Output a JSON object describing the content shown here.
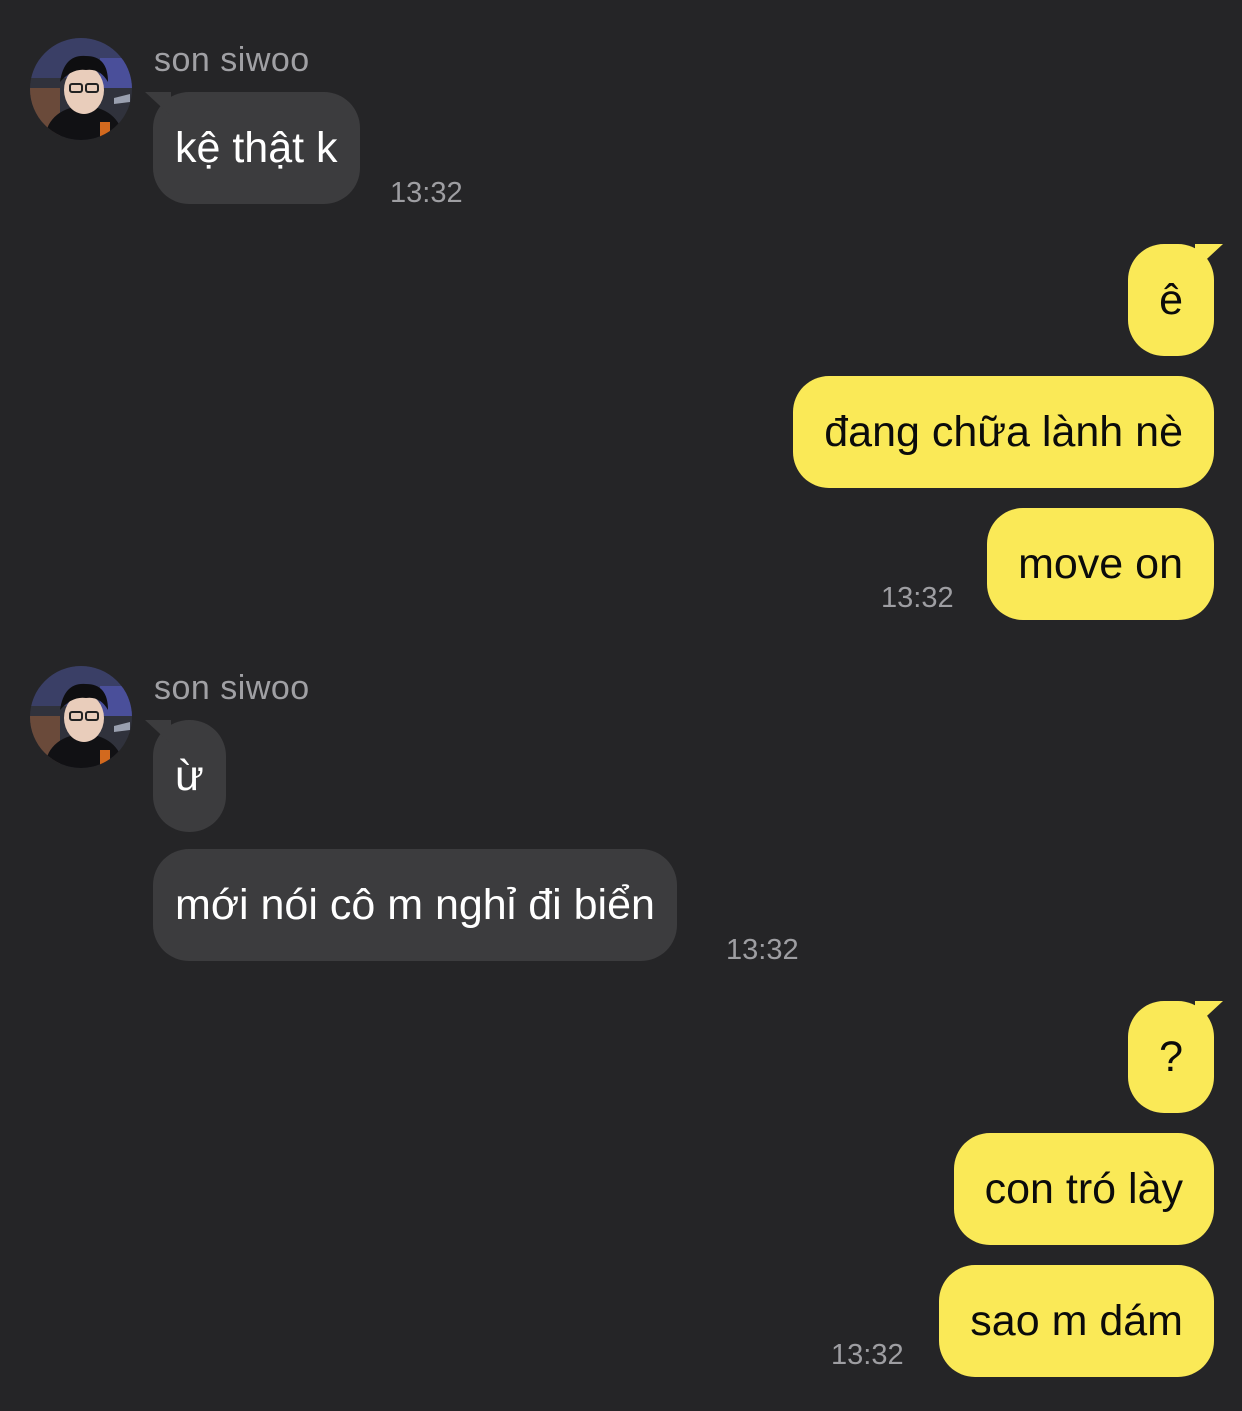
{
  "chat": {
    "messages": [
      {
        "direction": "incoming",
        "sender": "son siwoo",
        "avatar_icon": "profile-photo",
        "bubbles": [
          "kệ thật k"
        ],
        "time": "13:32"
      },
      {
        "direction": "outgoing",
        "bubbles": [
          "ê",
          "đang chữa lành nè",
          "move on"
        ],
        "time": "13:32"
      },
      {
        "direction": "incoming",
        "sender": "son siwoo",
        "avatar_icon": "profile-photo",
        "bubbles": [
          "ừ",
          "mới nói cô m nghỉ đi biển"
        ],
        "time": "13:32"
      },
      {
        "direction": "outgoing",
        "bubbles": [
          "?",
          "con tró lày",
          "sao m dám"
        ],
        "time": "13:32"
      }
    ]
  },
  "colors": {
    "background": "#252527",
    "incoming_bubble": "#3c3c3e",
    "outgoing_bubble": "#fae957",
    "timestamp": "#9e9ea2"
  }
}
